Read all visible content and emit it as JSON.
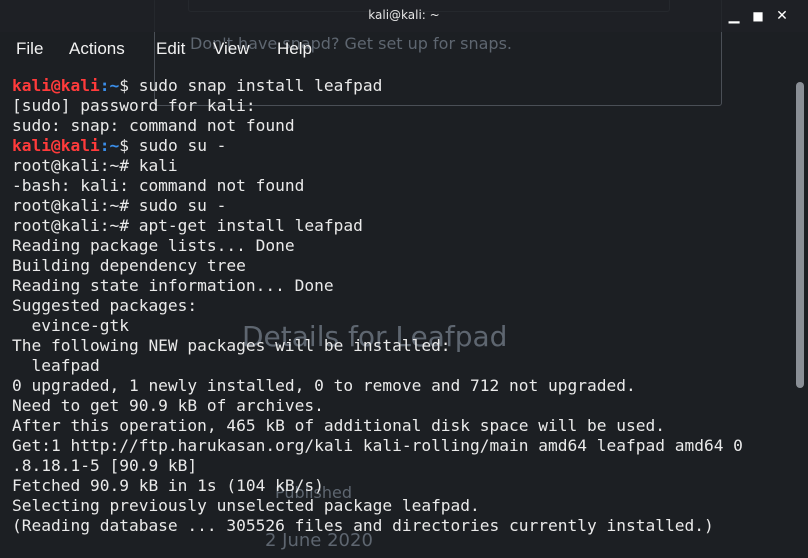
{
  "window": {
    "title": "kali@kali: ~"
  },
  "controls": {
    "minimize": "▁",
    "maximize": "■",
    "close": "✕"
  },
  "menu": [
    "File",
    "Actions",
    "Edit",
    "View",
    "Help"
  ],
  "background_ghost": {
    "snap_hint": "Don't have snapd? Get set up for snaps.",
    "details_heading": "Details for Leafpad",
    "published_label": "Published",
    "date": "2 June 2020"
  },
  "terminal": {
    "lines": [
      {
        "type": "prompt",
        "user": "kali@kali",
        "path": ":~",
        "sym": "$ ",
        "cmd": "sudo snap install leafpad"
      },
      {
        "type": "text",
        "text": "[sudo] password for kali:"
      },
      {
        "type": "text",
        "text": "sudo: snap: command not found"
      },
      {
        "type": "prompt",
        "user": "kali@kali",
        "path": ":~",
        "sym": "$ ",
        "cmd": "sudo su -"
      },
      {
        "type": "text",
        "text": "root@kali:~# kali"
      },
      {
        "type": "text",
        "text": "-bash: kali: command not found"
      },
      {
        "type": "text",
        "text": "root@kali:~# sudo su -"
      },
      {
        "type": "text",
        "text": "root@kali:~# apt-get install leafpad"
      },
      {
        "type": "text",
        "text": "Reading package lists... Done"
      },
      {
        "type": "text",
        "text": "Building dependency tree"
      },
      {
        "type": "text",
        "text": "Reading state information... Done"
      },
      {
        "type": "text",
        "text": "Suggested packages:"
      },
      {
        "type": "text",
        "text": "  evince-gtk"
      },
      {
        "type": "text",
        "text": "The following NEW packages will be installed:"
      },
      {
        "type": "text",
        "text": "  leafpad"
      },
      {
        "type": "text",
        "text": "0 upgraded, 1 newly installed, 0 to remove and 712 not upgraded."
      },
      {
        "type": "text",
        "text": "Need to get 90.9 kB of archives."
      },
      {
        "type": "text",
        "text": "After this operation, 465 kB of additional disk space will be used."
      },
      {
        "type": "text",
        "text": "Get:1 http://ftp.harukasan.org/kali kali-rolling/main amd64 leafpad amd64 0"
      },
      {
        "type": "text",
        "text": ".8.18.1-5 [90.9 kB]"
      },
      {
        "type": "text",
        "text": "Fetched 90.9 kB in 1s (104 kB/s)"
      },
      {
        "type": "text",
        "text": "Selecting previously unselected package leafpad."
      },
      {
        "type": "text",
        "text": "(Reading database ... 305526 files and directories currently installed.)"
      }
    ]
  },
  "colors": {
    "prompt_user": "#ff3b3b",
    "prompt_path": "#3b8eea",
    "text": "#eaeaea",
    "background": "#1c1f23"
  }
}
